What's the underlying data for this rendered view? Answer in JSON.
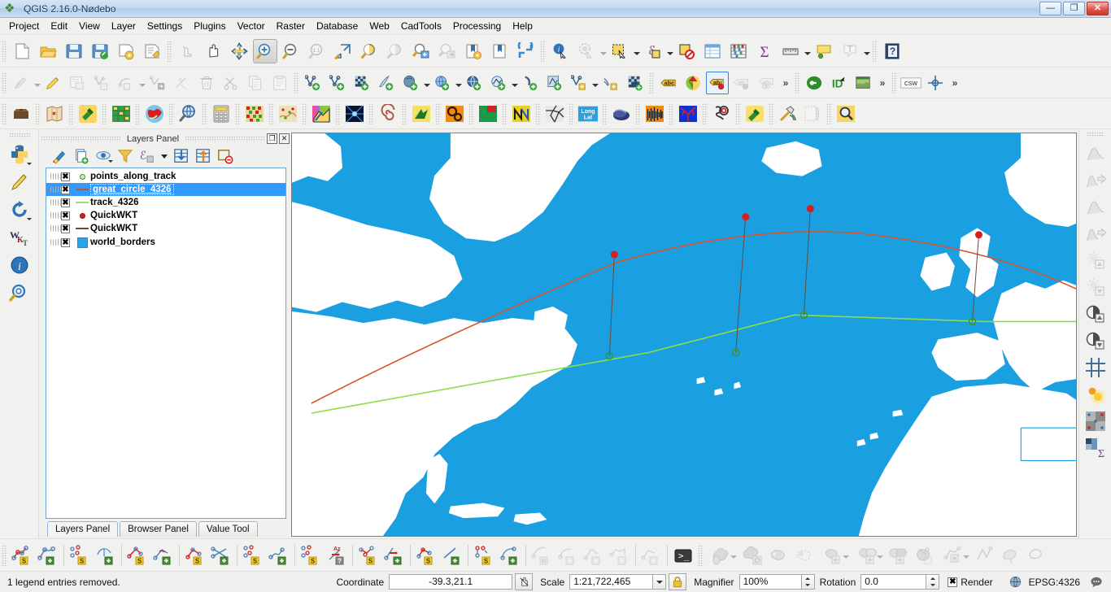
{
  "window": {
    "title": "QGIS 2.16.0-Nødebo",
    "app_icon": "qgis-leaf-icon",
    "minimize_label": "—",
    "maximize_label": "❐",
    "close_label": "✕"
  },
  "menu": {
    "items": [
      {
        "label": "Project",
        "accel": "P"
      },
      {
        "label": "Edit",
        "accel": "E"
      },
      {
        "label": "View",
        "accel": "V"
      },
      {
        "label": "Layer",
        "accel": "L"
      },
      {
        "label": "Settings",
        "accel": "S"
      },
      {
        "label": "Plugins",
        "accel": "P"
      },
      {
        "label": "Vector",
        "accel": "r"
      },
      {
        "label": "Raster",
        "accel": "R"
      },
      {
        "label": "Database",
        "accel": "D"
      },
      {
        "label": "Web",
        "accel": "W"
      },
      {
        "label": "CadTools",
        "accel": "C"
      },
      {
        "label": "Processing",
        "accel": "c"
      },
      {
        "label": "Help",
        "accel": "H"
      }
    ]
  },
  "toolbar_row1": {
    "icons": [
      "new-project-icon",
      "open-project-icon",
      "save-project-icon",
      "save-project-as-icon",
      "new-print-composer-icon",
      "composer-manager-icon",
      "touch-zoom-icon",
      "pan-map-icon",
      "pan-to-selection-icon",
      "zoom-in-icon",
      "zoom-out-icon",
      "zoom-native-icon",
      "zoom-full-icon",
      "zoom-to-selection-icon",
      "zoom-to-layer-icon",
      "zoom-last-icon",
      "zoom-next-icon",
      "new-bookmark-icon",
      "show-bookmarks-icon",
      "refresh-icon",
      "identify-features-icon",
      "run-feature-action-icon",
      "select-features-icon",
      "deselect-icon",
      "deselect-all-icon",
      "open-attribute-table-icon",
      "field-calculator-icon",
      "statistical-summary-icon",
      "measure-line-icon",
      "map-tips-icon",
      "text-annotation-icon",
      "help-contents-icon"
    ],
    "active_tool": "zoom-in-icon"
  },
  "toolbar_row2": {
    "icons": [
      "current-edits-icon",
      "toggle-editing-icon",
      "save-layer-edits-icon",
      "add-feature-icon",
      "add-circular-string-icon",
      "move-feature-icon",
      "node-tool-icon",
      "delete-selected-icon",
      "cut-features-icon",
      "copy-features-icon",
      "paste-features-icon",
      "add-vector-layer-icon",
      "add-delimited-text-layer-icon",
      "add-raster-layer-icon",
      "add-spatialite-layer-icon",
      "add-postgis-layer-icon",
      "add-wms-layer-icon",
      "add-wfs-layer-icon",
      "add-wcs-layer-icon",
      "add-oracle-layer-icon",
      "add-db2-layer-icon",
      "new-shapefile-layer-icon",
      "new-virtual-layer-icon",
      "new-mesh-layer-icon",
      "label-icon",
      "style-manager-icon",
      "layer-labeling-icon",
      "layer-diagram-icon",
      "show-hide-labels-icon",
      "plugin-manager-icon",
      "python-console-icon",
      "georeferencer-icon",
      "csw-search-icon",
      "crs-status-icon"
    ]
  },
  "toolbar_row3": {
    "icons": [
      "toolbox-icon",
      "old-map-icon",
      "plugin-green-icon",
      "grid-yellow-icon",
      "globe-red-icon",
      "zoom-globe-icon",
      "calculator-icon",
      "raster-mix-icon",
      "terrain-points-icon",
      "rainbow-icon",
      "magicwand-icon",
      "tunnel-icon",
      "spiral-icon",
      "green-arrow-icon",
      "gears-orange-icon",
      "green-red-box-icon",
      "waveform-icon",
      "crack-pattern-icon",
      "long-lat-icon",
      "mouse-icon",
      "barcode-orange-icon",
      "river-network-icon",
      "search-magnifier-icon",
      "plug-yellow-icon",
      "hammer-tools-icon",
      "scroll-icon",
      "zoom-yellow-icon"
    ]
  },
  "left_strip": {
    "icons": [
      "python-plugin-icon",
      "pencil-tool-icon",
      "arrow-loop-icon",
      "wkt-icon",
      "info-blue-icon",
      "zoom-search-icon"
    ]
  },
  "right_strip": {
    "icons": [
      "histogram-icon",
      "histogram-stretch-icon",
      "histogram-local-icon",
      "histogram-stretch-local-icon",
      "brightness-up-icon",
      "brightness-down-icon",
      "contrast-up-icon",
      "contrast-down-icon",
      "grid-cross-icon",
      "glow-dot-icon",
      "raster-points-icon",
      "raster-sigma-icon"
    ]
  },
  "layers_panel": {
    "title": "Layers Panel",
    "undock_label": "❐",
    "close_label": "✕",
    "tools": [
      "open-layer-styling-icon",
      "add-group-icon",
      "manage-visibility-icon",
      "filter-legend-icon",
      "filter-legend-expression-icon",
      "expand-all-icon",
      "collapse-all-icon",
      "remove-layer-icon"
    ],
    "layers": [
      {
        "name": "points_along_track",
        "symbol": "point-hollow-green",
        "color": "#86c06b",
        "checked": true,
        "selected": false
      },
      {
        "name": "great_circle_4326",
        "symbol": "line",
        "color": "#c0572b",
        "checked": true,
        "selected": true
      },
      {
        "name": "track_4326",
        "symbol": "line",
        "color": "#92e35e",
        "checked": true,
        "selected": false
      },
      {
        "name": "QuickWKT",
        "symbol": "point-filled-red",
        "color": "#d42020",
        "checked": true,
        "selected": false
      },
      {
        "name": "QuickWKT",
        "symbol": "line",
        "color": "#6b4a3a",
        "checked": true,
        "selected": false
      },
      {
        "name": "world_borders",
        "symbol": "polygon",
        "color": "#27a3e8",
        "checked": true,
        "selected": false
      }
    ],
    "checkbox_glyph": "✖",
    "tabs": [
      {
        "label": "Layers Panel",
        "active": true
      },
      {
        "label": "Browser Panel",
        "active": false
      },
      {
        "label": "Value Tool",
        "active": false
      }
    ]
  },
  "map": {
    "ocean_color": "#1a9fe0",
    "land_color": "#ffffff",
    "great_circle_color": "#d8552c",
    "track_color": "#8ede4a",
    "connector_color": "#6b4a3a",
    "red_point_color": "#d42020",
    "green_point_color": "#59b832"
  },
  "bottom_toolbar": {
    "icons": [
      "cad-select-points-icon",
      "cad-add-points-icon",
      "cad-select-scatter-icon",
      "cad-add-curve-icon",
      "cad-select-angle-icon",
      "cad-add-angle-icon",
      "cad-select-segment-icon",
      "cad-add-cross-icon",
      "cad-select-cluster-icon",
      "cad-add-cluster-icon",
      "cad-select-group-icon",
      "cad-azimuth-icon",
      "cad-select-pair-icon",
      "cad-add-arrow-icon",
      "cad-select-poly-icon",
      "cad-add-line-icon",
      "cad-select-dual-icon",
      "cad-add-arc-icon",
      "cad-measure-m-icon",
      "cad-add-curve2-icon",
      "cad-add-curve3-icon",
      "cad-add-network-icon",
      "cad-add-node-icon",
      "python-console-icon",
      "geom-union-icon",
      "geom-union-settings-icon",
      "geom-single-icon",
      "geom-dashed-icon",
      "geom-split-icon",
      "geom-overlap-icon",
      "geom-intersect-icon",
      "geom-multipart-icon",
      "geom-node-edit-icon",
      "geom-vertex-icon",
      "geom-smooth-icon",
      "geom-simplify-icon"
    ]
  },
  "statusbar": {
    "message": "1 legend entries removed.",
    "coordinate_label": "Coordinate",
    "coordinate_value": "-39.3,21.1",
    "coordinate_toggle_icon": "coordinate-capture-icon",
    "scale_label": "Scale",
    "scale_value": "1:21,722,465",
    "scale_lock_icon": "lock-icon",
    "magnifier_label": "Magnifier",
    "magnifier_value": "100%",
    "rotation_label": "Rotation",
    "rotation_value": "0.0",
    "render_label": "Render",
    "render_checked": true,
    "crs_label": "EPSG:4326",
    "crs_icon": "crs-globe-icon",
    "messages_icon": "messages-bubble-icon"
  }
}
